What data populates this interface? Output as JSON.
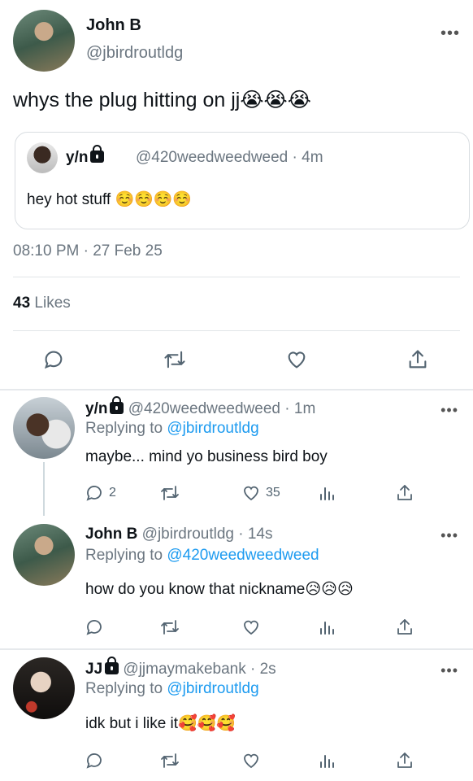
{
  "main_tweet": {
    "name": "John B",
    "handle": "@jbirdroutldg",
    "more": "•••",
    "text": "whys the plug hitting on jj😭😭😭",
    "quote": {
      "name": "y/n",
      "handle_time": "@420weedweedweed · 4m",
      "text": "hey hot stuff ☺️☺️☺️☺️"
    },
    "timestamp": "08:10 PM · 27 Feb 25",
    "likes_count": "43",
    "likes_label": "Likes"
  },
  "replies": [
    {
      "name": "y/n",
      "protected": true,
      "handle_time": "@420weedweedweed · 1m",
      "replying_prefix": "Replying to",
      "replying_to": "@jbirdroutldg",
      "text": "maybe... mind yo business bird boy",
      "reply_count": "2",
      "like_count": "35"
    },
    {
      "name": "John B",
      "protected": false,
      "handle_time": "@jbirdroutldg · 14s",
      "replying_prefix": "Replying to",
      "replying_to": "@420weedweedweed",
      "text": "how do you know that nickname😥😥😥",
      "reply_count": "",
      "like_count": ""
    },
    {
      "name": "JJ",
      "protected": true,
      "handle_time": "@jjmaymakebank · 2s",
      "replying_prefix": "Replying to",
      "replying_to": "@jbirdroutldg",
      "text": "idk but i like it🥰🥰🥰",
      "reply_count": "",
      "like_count": ""
    }
  ],
  "icons": [
    "reply-icon",
    "retweet-icon",
    "like-icon",
    "share-icon",
    "views-icon",
    "lock-icon",
    "more-icon"
  ],
  "colors": {
    "link": "#1d9bf0",
    "secondary_text": "#6b7680",
    "divider": "#e1e5e8"
  }
}
